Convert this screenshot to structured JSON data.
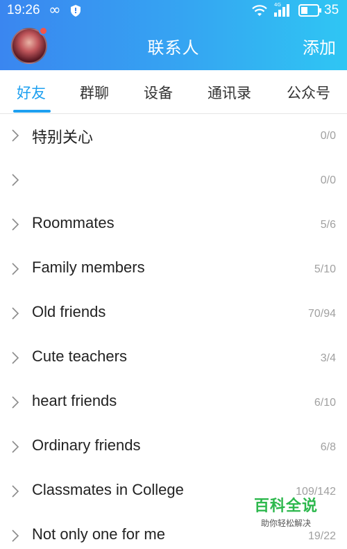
{
  "status_bar": {
    "time": "19:26",
    "network": "4G",
    "battery": "35"
  },
  "header": {
    "title": "联系人",
    "add_label": "添加"
  },
  "tabs": [
    {
      "label": "好友",
      "active": true
    },
    {
      "label": "群聊",
      "active": false
    },
    {
      "label": "设备",
      "active": false
    },
    {
      "label": "通讯录",
      "active": false
    },
    {
      "label": "公众号",
      "active": false
    }
  ],
  "groups": [
    {
      "name": "特别关心",
      "count": "0/0"
    },
    {
      "name": "",
      "count": "0/0"
    },
    {
      "name": "Roommates",
      "count": "5/6"
    },
    {
      "name": "Family members",
      "count": "5/10"
    },
    {
      "name": "Old friends",
      "count": "70/94"
    },
    {
      "name": "Cute teachers",
      "count": "3/4"
    },
    {
      "name": "heart friends",
      "count": "6/10"
    },
    {
      "name": "Ordinary friends",
      "count": "6/8"
    },
    {
      "name": "Classmates in College",
      "count": "109/142"
    },
    {
      "name": "Not only one for me",
      "count": "19/22"
    }
  ],
  "watermark": {
    "title": "百科全说",
    "subtitle": "助你轻松解决"
  },
  "colors": {
    "header_start": "#3a86f0",
    "header_end": "#2fc6f3",
    "tab_active": "#1ea0f0",
    "count_gray": "#a0a0a0",
    "badge_red": "#f2564a",
    "watermark_green": "#2db84d"
  },
  "icons": {
    "status": [
      "infinity-icon",
      "shield-icon",
      "wifi-icon",
      "signal-icon",
      "battery-icon"
    ],
    "row": "chevron-right-icon"
  }
}
